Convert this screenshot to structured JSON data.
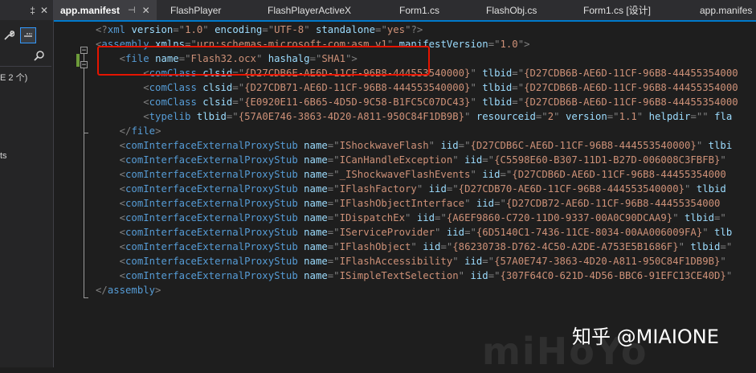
{
  "left_panel": {
    "title_icons": [
      "pin-icon",
      "close-icon"
    ],
    "title_glyphs": [
      "‡",
      "✕"
    ],
    "tool_icons": [
      "wrench-icon",
      "dash-toggle-icon"
    ],
    "search_icon": "search-icon",
    "text1": "E 2 个)",
    "text2": "ts"
  },
  "tabs": [
    {
      "label": "app.manifest",
      "active": true,
      "pin": "⊣",
      "close": "✕"
    },
    {
      "label": "FlashPlayer"
    },
    {
      "label": "FlashPlayerActiveX"
    },
    {
      "label": "Form1.cs"
    },
    {
      "label": "FlashObj.cs"
    },
    {
      "label": "Form1.cs [设计]"
    },
    {
      "label": "app.manifes"
    }
  ],
  "colors": {
    "keyword": "#569cd6",
    "attribute": "#9cdcfe",
    "string": "#ce9178",
    "punctuation": "#808080",
    "highlight_box": "#e51400",
    "accent": "#007acc"
  },
  "code_lines": [
    [
      [
        "b",
        "<?"
      ],
      [
        "e",
        "xml"
      ],
      [
        "p",
        " "
      ],
      [
        "a",
        "version"
      ],
      [
        "b",
        "=\""
      ],
      [
        "v",
        "1.0"
      ],
      [
        "b",
        "\" "
      ],
      [
        "a",
        "encoding"
      ],
      [
        "b",
        "=\""
      ],
      [
        "v",
        "UTF-8"
      ],
      [
        "b",
        "\" "
      ],
      [
        "a",
        "standalone"
      ],
      [
        "b",
        "=\""
      ],
      [
        "v",
        "yes"
      ],
      [
        "b",
        "\"?>"
      ]
    ],
    [
      [
        "b",
        "<"
      ],
      [
        "e",
        "assembly"
      ],
      [
        "p",
        " "
      ],
      [
        "a",
        "xmlns"
      ],
      [
        "b",
        "=\""
      ],
      [
        "v",
        "urn:schemas-microsoft-com:asm.v1"
      ],
      [
        "b",
        "\" "
      ],
      [
        "a",
        "manifestVersion"
      ],
      [
        "b",
        "=\""
      ],
      [
        "v",
        "1.0"
      ],
      [
        "b",
        "\">"
      ]
    ],
    [
      [
        "p",
        "    "
      ],
      [
        "b",
        "<"
      ],
      [
        "e",
        "file"
      ],
      [
        "p",
        " "
      ],
      [
        "a",
        "name"
      ],
      [
        "b",
        "=\""
      ],
      [
        "v",
        "Flash32.ocx"
      ],
      [
        "b",
        "\" "
      ],
      [
        "a",
        "hashalg"
      ],
      [
        "b",
        "=\""
      ],
      [
        "v",
        "SHA1"
      ],
      [
        "b",
        "\">"
      ]
    ],
    [
      [
        "p",
        "        "
      ],
      [
        "b",
        "<"
      ],
      [
        "e",
        "comClass"
      ],
      [
        "p",
        " "
      ],
      [
        "a",
        "clsid"
      ],
      [
        "b",
        "=\""
      ],
      [
        "v",
        "{D27CDB6E-AE6D-11CF-96B8-444553540000}"
      ],
      [
        "b",
        "\" "
      ],
      [
        "a",
        "tlbid"
      ],
      [
        "b",
        "=\""
      ],
      [
        "v",
        "{D27CDB6B-AE6D-11CF-96B8-44455354000"
      ]
    ],
    [
      [
        "p",
        "        "
      ],
      [
        "b",
        "<"
      ],
      [
        "e",
        "comClass"
      ],
      [
        "p",
        " "
      ],
      [
        "a",
        "clsid"
      ],
      [
        "b",
        "=\""
      ],
      [
        "v",
        "{D27CDB71-AE6D-11CF-96B8-444553540000}"
      ],
      [
        "b",
        "\" "
      ],
      [
        "a",
        "tlbid"
      ],
      [
        "b",
        "=\""
      ],
      [
        "v",
        "{D27CDB6B-AE6D-11CF-96B8-44455354000"
      ]
    ],
    [
      [
        "p",
        "        "
      ],
      [
        "b",
        "<"
      ],
      [
        "e",
        "comClass"
      ],
      [
        "p",
        " "
      ],
      [
        "a",
        "clsid"
      ],
      [
        "b",
        "=\""
      ],
      [
        "v",
        "{E0920E11-6B65-4D5D-9C58-B1FC5C07DC43}"
      ],
      [
        "b",
        "\" "
      ],
      [
        "a",
        "tlbid"
      ],
      [
        "b",
        "=\""
      ],
      [
        "v",
        "{D27CDB6B-AE6D-11CF-96B8-44455354000"
      ]
    ],
    [
      [
        "p",
        "        "
      ],
      [
        "b",
        "<"
      ],
      [
        "e",
        "typelib"
      ],
      [
        "p",
        " "
      ],
      [
        "a",
        "tlbid"
      ],
      [
        "b",
        "=\""
      ],
      [
        "v",
        "{57A0E746-3863-4D20-A811-950C84F1DB9B}"
      ],
      [
        "b",
        "\" "
      ],
      [
        "a",
        "resourceid"
      ],
      [
        "b",
        "=\""
      ],
      [
        "v",
        "2"
      ],
      [
        "b",
        "\" "
      ],
      [
        "a",
        "version"
      ],
      [
        "b",
        "=\""
      ],
      [
        "v",
        "1.1"
      ],
      [
        "b",
        "\" "
      ],
      [
        "a",
        "helpdir"
      ],
      [
        "b",
        "=\""
      ],
      [
        "b",
        "\" "
      ],
      [
        "a",
        "fla"
      ]
    ],
    [
      [
        "p",
        "    "
      ],
      [
        "b",
        "</"
      ],
      [
        "e",
        "file"
      ],
      [
        "b",
        ">"
      ]
    ],
    [
      [
        "p",
        "    "
      ],
      [
        "b",
        "<"
      ],
      [
        "e",
        "comInterfaceExternalProxyStub"
      ],
      [
        "p",
        " "
      ],
      [
        "a",
        "name"
      ],
      [
        "b",
        "=\""
      ],
      [
        "v",
        "IShockwaveFlash"
      ],
      [
        "b",
        "\" "
      ],
      [
        "a",
        "iid"
      ],
      [
        "b",
        "=\""
      ],
      [
        "v",
        "{D27CDB6C-AE6D-11CF-96B8-444553540000}"
      ],
      [
        "b",
        "\" "
      ],
      [
        "a",
        "tlbi"
      ]
    ],
    [
      [
        "p",
        "    "
      ],
      [
        "b",
        "<"
      ],
      [
        "e",
        "comInterfaceExternalProxyStub"
      ],
      [
        "p",
        " "
      ],
      [
        "a",
        "name"
      ],
      [
        "b",
        "=\""
      ],
      [
        "v",
        "ICanHandleException"
      ],
      [
        "b",
        "\" "
      ],
      [
        "a",
        "iid"
      ],
      [
        "b",
        "=\""
      ],
      [
        "v",
        "{C5598E60-B307-11D1-B27D-006008C3FBFB}"
      ],
      [
        "b",
        "\" "
      ]
    ],
    [
      [
        "p",
        "    "
      ],
      [
        "b",
        "<"
      ],
      [
        "e",
        "comInterfaceExternalProxyStub"
      ],
      [
        "p",
        " "
      ],
      [
        "a",
        "name"
      ],
      [
        "b",
        "=\""
      ],
      [
        "v",
        "_IShockwaveFlashEvents"
      ],
      [
        "b",
        "\" "
      ],
      [
        "a",
        "iid"
      ],
      [
        "b",
        "=\""
      ],
      [
        "v",
        "{D27CDB6D-AE6D-11CF-96B8-44455354000"
      ]
    ],
    [
      [
        "p",
        "    "
      ],
      [
        "b",
        "<"
      ],
      [
        "e",
        "comInterfaceExternalProxyStub"
      ],
      [
        "p",
        " "
      ],
      [
        "a",
        "name"
      ],
      [
        "b",
        "=\""
      ],
      [
        "v",
        "IFlashFactory"
      ],
      [
        "b",
        "\" "
      ],
      [
        "a",
        "iid"
      ],
      [
        "b",
        "=\""
      ],
      [
        "v",
        "{D27CDB70-AE6D-11CF-96B8-444553540000}"
      ],
      [
        "b",
        "\" "
      ],
      [
        "a",
        "tlbid"
      ]
    ],
    [
      [
        "p",
        "    "
      ],
      [
        "b",
        "<"
      ],
      [
        "e",
        "comInterfaceExternalProxyStub"
      ],
      [
        "p",
        " "
      ],
      [
        "a",
        "name"
      ],
      [
        "b",
        "=\""
      ],
      [
        "v",
        "IFlashObjectInterface"
      ],
      [
        "b",
        "\" "
      ],
      [
        "a",
        "iid"
      ],
      [
        "b",
        "=\""
      ],
      [
        "v",
        "{D27CDB72-AE6D-11CF-96B8-44455354000"
      ]
    ],
    [
      [
        "p",
        "    "
      ],
      [
        "b",
        "<"
      ],
      [
        "e",
        "comInterfaceExternalProxyStub"
      ],
      [
        "p",
        " "
      ],
      [
        "a",
        "name"
      ],
      [
        "b",
        "=\""
      ],
      [
        "v",
        "IDispatchEx"
      ],
      [
        "b",
        "\" "
      ],
      [
        "a",
        "iid"
      ],
      [
        "b",
        "=\""
      ],
      [
        "v",
        "{A6EF9860-C720-11D0-9337-00A0C90DCAA9}"
      ],
      [
        "b",
        "\" "
      ],
      [
        "a",
        "tlbid"
      ],
      [
        "b",
        "=\""
      ]
    ],
    [
      [
        "p",
        "    "
      ],
      [
        "b",
        "<"
      ],
      [
        "e",
        "comInterfaceExternalProxyStub"
      ],
      [
        "p",
        " "
      ],
      [
        "a",
        "name"
      ],
      [
        "b",
        "=\""
      ],
      [
        "v",
        "IServiceProvider"
      ],
      [
        "b",
        "\" "
      ],
      [
        "a",
        "iid"
      ],
      [
        "b",
        "=\""
      ],
      [
        "v",
        "{6D5140C1-7436-11CE-8034-00AA006009FA}"
      ],
      [
        "b",
        "\" "
      ],
      [
        "a",
        "tlb"
      ]
    ],
    [
      [
        "p",
        "    "
      ],
      [
        "b",
        "<"
      ],
      [
        "e",
        "comInterfaceExternalProxyStub"
      ],
      [
        "p",
        " "
      ],
      [
        "a",
        "name"
      ],
      [
        "b",
        "=\""
      ],
      [
        "v",
        "IFlashObject"
      ],
      [
        "b",
        "\" "
      ],
      [
        "a",
        "iid"
      ],
      [
        "b",
        "=\""
      ],
      [
        "v",
        "{86230738-D762-4C50-A2DE-A753E5B1686F}"
      ],
      [
        "b",
        "\" "
      ],
      [
        "a",
        "tlbid"
      ],
      [
        "b",
        "=\""
      ]
    ],
    [
      [
        "p",
        "    "
      ],
      [
        "b",
        "<"
      ],
      [
        "e",
        "comInterfaceExternalProxyStub"
      ],
      [
        "p",
        " "
      ],
      [
        "a",
        "name"
      ],
      [
        "b",
        "=\""
      ],
      [
        "v",
        "IFlashAccessibility"
      ],
      [
        "b",
        "\" "
      ],
      [
        "a",
        "iid"
      ],
      [
        "b",
        "=\""
      ],
      [
        "v",
        "{57A0E747-3863-4D20-A811-950C84F1DB9B}"
      ],
      [
        "b",
        "\" "
      ]
    ],
    [
      [
        "p",
        "    "
      ],
      [
        "b",
        "<"
      ],
      [
        "e",
        "comInterfaceExternalProxyStub"
      ],
      [
        "p",
        " "
      ],
      [
        "a",
        "name"
      ],
      [
        "b",
        "=\""
      ],
      [
        "v",
        "ISimpleTextSelection"
      ],
      [
        "b",
        "\" "
      ],
      [
        "a",
        "iid"
      ],
      [
        "b",
        "=\""
      ],
      [
        "v",
        "{307F64C0-621D-4D56-BBC6-91EFC13CE40D}"
      ],
      [
        "b",
        "\" "
      ]
    ],
    [
      [
        "b",
        "</"
      ],
      [
        "e",
        "assembly"
      ],
      [
        "b",
        ">"
      ]
    ]
  ],
  "watermark": {
    "logo": "miHoYo",
    "zhihu": "知乎 @MIAIONE"
  }
}
